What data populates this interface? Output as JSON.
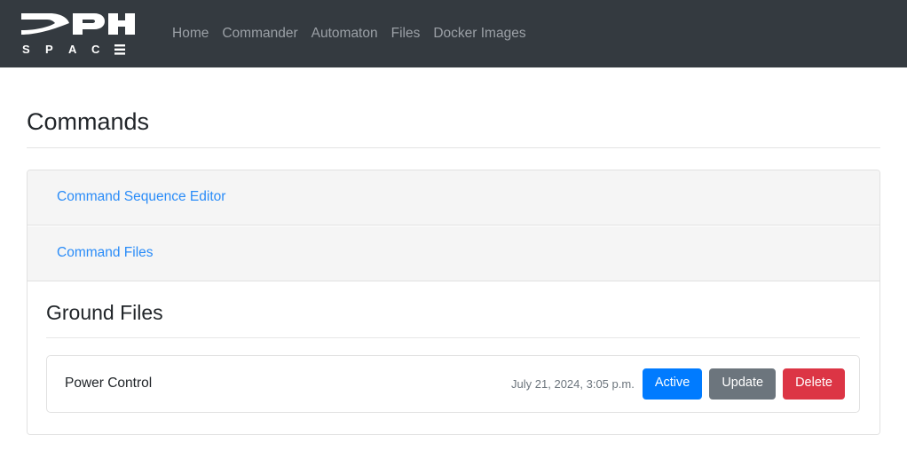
{
  "navbar": {
    "brand": {
      "wordmark": "DPHI",
      "subtitle_letters": [
        "S",
        "P",
        "A",
        "C"
      ],
      "subtitle_final_glyph": "≡",
      "logo_color": "#ffffff",
      "background": "#343a40"
    },
    "links": [
      {
        "label": "Home"
      },
      {
        "label": "Commander"
      },
      {
        "label": "Automaton"
      },
      {
        "label": "Files"
      },
      {
        "label": "Docker Images"
      }
    ],
    "link_color": "#9ba0a6"
  },
  "main": {
    "page_title": "Commands",
    "accordion": [
      {
        "label": "Command Sequence Editor"
      },
      {
        "label": "Command Files"
      }
    ],
    "link_color": "#2a8cf8",
    "section": {
      "title": "Ground Files",
      "files": [
        {
          "name": "Power Control",
          "timestamp": "July 21, 2024, 3:05 p.m.",
          "buttons": [
            {
              "label": "Active",
              "style": "primary",
              "color": "#007bff"
            },
            {
              "label": "Update",
              "style": "secondary",
              "color": "#6c757d"
            },
            {
              "label": "Delete",
              "style": "danger",
              "color": "#dc3545"
            }
          ]
        }
      ]
    }
  }
}
